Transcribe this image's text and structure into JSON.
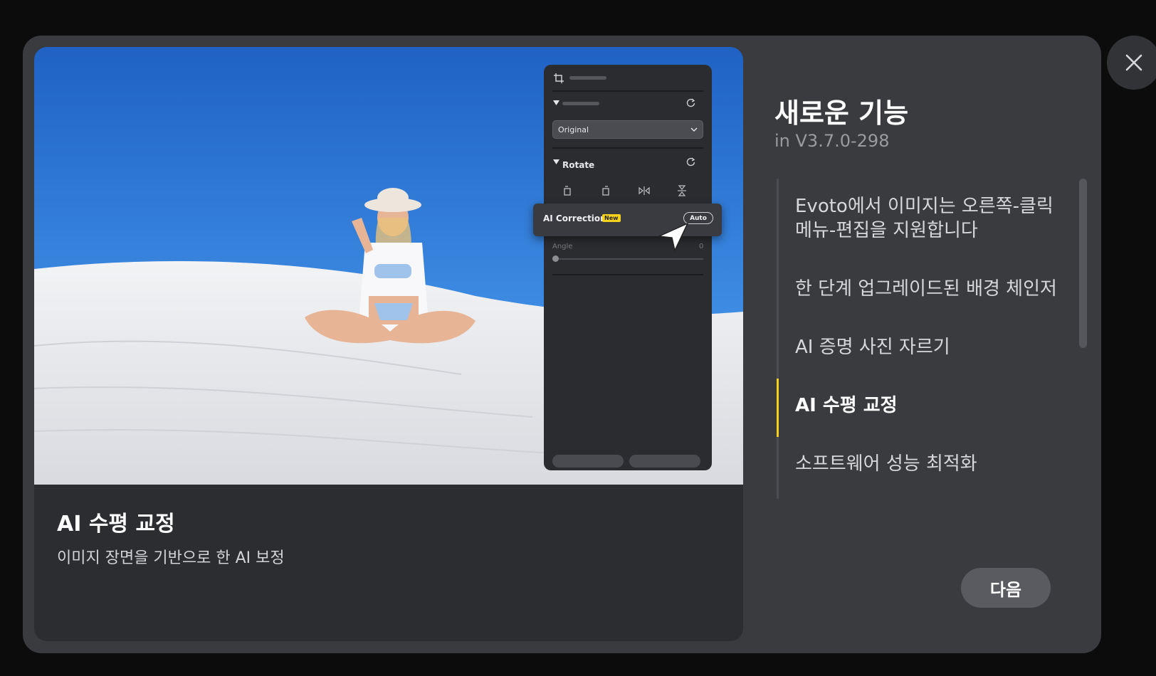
{
  "dialog": {
    "title": "새로운 기능",
    "version": "in V3.7.0-298",
    "next_label": "다음",
    "close_icon": "close-icon"
  },
  "card": {
    "title": "AI 수평 교정",
    "description": "이미지 장면을 기반으로 한 AI 보정"
  },
  "features": [
    {
      "label": "Evoto에서 이미지는 오른쪽-클릭 메뉴-편집을 지원합니다",
      "active": false
    },
    {
      "label": "한 단계 업그레이드된 배경 체인저",
      "active": false
    },
    {
      "label": "AI 증명 사진 자르기",
      "active": false
    },
    {
      "label": "AI 수평 교정",
      "active": true
    },
    {
      "label": "소프트웨어 성능 최적화",
      "active": false
    }
  ],
  "preview_panel": {
    "crop_select": "Original",
    "rotate_label": "Rotate",
    "angle_label": "Angle",
    "angle_value": "0",
    "ai_correction_label": "AI Correction",
    "new_badge": "New",
    "auto_button": "Auto"
  },
  "colors": {
    "accent": "#f4cf1c",
    "background": "#0c0c0d",
    "modal": "#3a3b3f"
  }
}
